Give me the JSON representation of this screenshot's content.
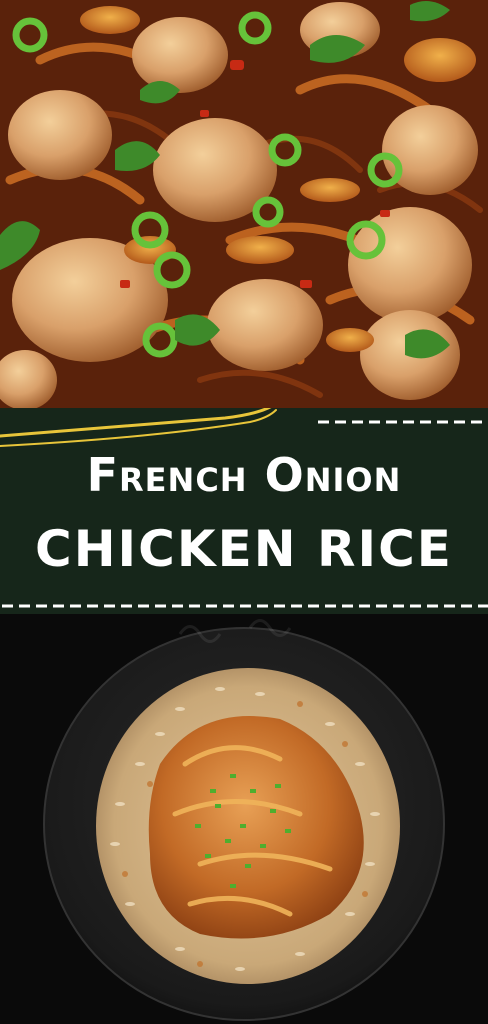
{
  "banner": {
    "title_line1": "French Onion",
    "title_line2": "CHICKEN RICE"
  },
  "colors": {
    "banner_bg": "#16261a",
    "accent_stroke": "#e8c53a",
    "dash_white": "#ffffff"
  },
  "images": {
    "top": "chicken-onion-closeup-photo",
    "bottom": "chicken-rice-bowl-photo"
  }
}
